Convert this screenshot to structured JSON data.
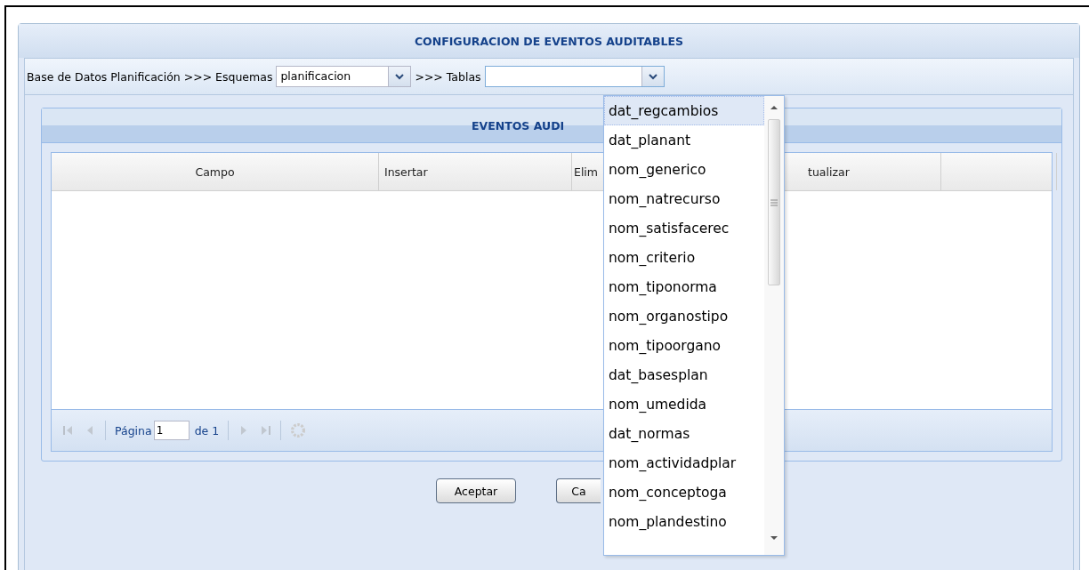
{
  "title": "CONFIGURACION DE EVENTOS AUDITABLES",
  "toolbar": {
    "database_label": "Base de Datos Planificación >>> Esquemas",
    "schema_combo": {
      "value": "planificacion"
    },
    "tables_label": ">>> Tablas",
    "tables_combo": {
      "expanded": true
    }
  },
  "tables_list": [
    {
      "label": "dat_regcambios",
      "selected": true
    },
    {
      "label": "dat_planant",
      "selected": false
    },
    {
      "label": "nom_generico",
      "selected": false
    },
    {
      "label": "nom_natrecurso",
      "selected": false
    },
    {
      "label": "nom_satisfacerec",
      "selected": false
    },
    {
      "label": "nom_criterio",
      "selected": false
    },
    {
      "label": "nom_tiponorma",
      "selected": false
    },
    {
      "label": "nom_organostipo",
      "selected": false
    },
    {
      "label": "nom_tipoorgano",
      "selected": false
    },
    {
      "label": "dat_basesplan",
      "selected": false
    },
    {
      "label": "nom_umedida",
      "selected": false
    },
    {
      "label": "dat_normas",
      "selected": false
    },
    {
      "label": "nom_actividadplar",
      "selected": false
    },
    {
      "label": "nom_conceptoga",
      "selected": false
    },
    {
      "label": "nom_plandestino",
      "selected": false
    }
  ],
  "events_panel": {
    "title": "EVENTOS AUDI",
    "columns": [
      "Campo",
      "Insertar",
      "Elim",
      "tualizar"
    ],
    "paging": {
      "page_label": "Página",
      "page": "1",
      "of_label": "de 1",
      "first_disabled": true,
      "prev_disabled": true,
      "next_disabled": true,
      "last_disabled": true
    }
  },
  "buttons": [
    {
      "label": "Aceptar"
    },
    {
      "label": "Ca"
    }
  ]
}
